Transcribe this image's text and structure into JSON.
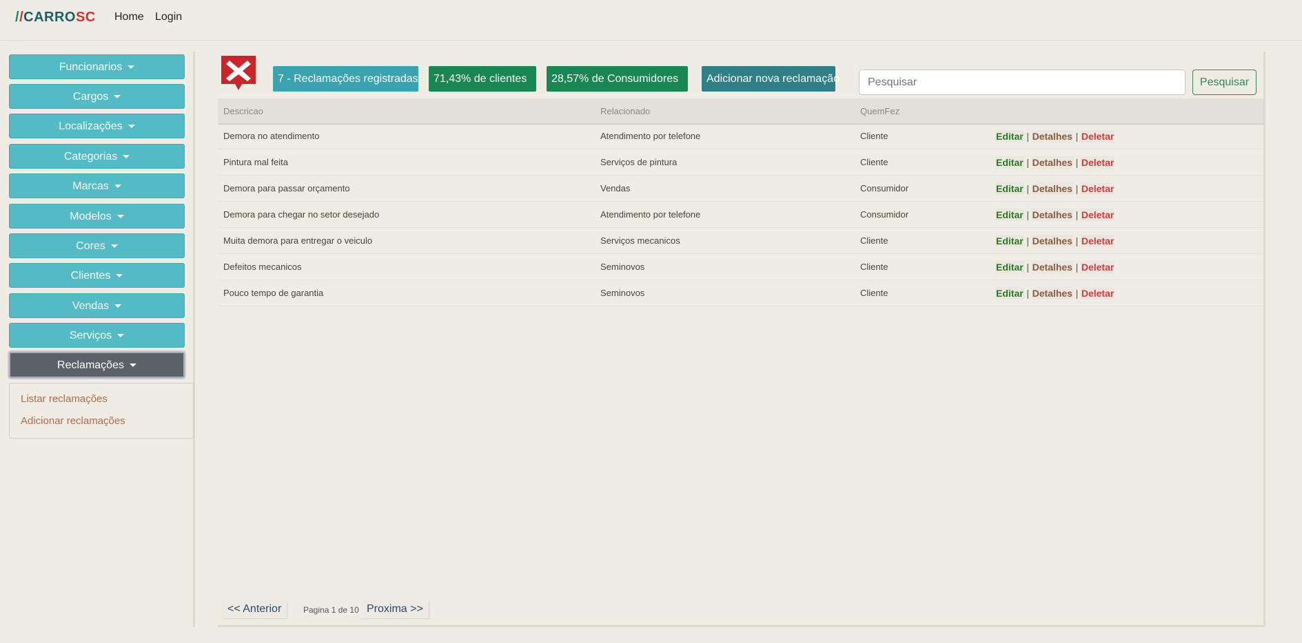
{
  "brand": {
    "mark": "/",
    "name_a": "CARRO",
    "name_b": "SC"
  },
  "nav": {
    "home": "Home",
    "login": "Login"
  },
  "sidebar": {
    "items": [
      {
        "label": "Funcionarios"
      },
      {
        "label": "Cargos"
      },
      {
        "label": "Localizações"
      },
      {
        "label": "Categorias"
      },
      {
        "label": "Marcas"
      },
      {
        "label": "Modelos"
      },
      {
        "label": "Cores"
      },
      {
        "label": "Clientes"
      },
      {
        "label": "Vendas"
      },
      {
        "label": "Serviços"
      },
      {
        "label": "Reclamações",
        "active": true
      }
    ],
    "dropdown": {
      "list": "Listar reclamações",
      "add": "Adicionar reclamações"
    }
  },
  "stats": {
    "total": "7 - Reclamações registradas",
    "clientes": "71,43% de clientes",
    "consumidores": "28,57% de Consumidores",
    "add_button": "Adicionar nova reclamação"
  },
  "search": {
    "placeholder": "Pesquisar",
    "button": "Pesquisar"
  },
  "table": {
    "headers": [
      "Descricao",
      "Relacionado",
      "QuemFez",
      ""
    ],
    "actions": {
      "edit": "Editar",
      "details": "Detalhes",
      "delete": "Deletar",
      "sep": "|"
    },
    "rows": [
      {
        "descricao": "Demora no atendimento",
        "relacionado": "Atendimento por telefone",
        "quemfez": "Cliente"
      },
      {
        "descricao": "Pintura mal feita",
        "relacionado": "Serviços de pintura",
        "quemfez": "Cliente"
      },
      {
        "descricao": "Demora para passar orçamento",
        "relacionado": "Vendas",
        "quemfez": "Consumidor"
      },
      {
        "descricao": "Demora para chegar no setor desejado",
        "relacionado": "Atendimento por telefone",
        "quemfez": "Consumidor"
      },
      {
        "descricao": "Muita demora para entregar o veiculo",
        "relacionado": "Serviços mecanicos",
        "quemfez": "Cliente"
      },
      {
        "descricao": "Defeitos mecanicos",
        "relacionado": "Seminovos",
        "quemfez": "Cliente"
      },
      {
        "descricao": "Pouco tempo de garantia",
        "relacionado": "Seminovos",
        "quemfez": "Cliente"
      }
    ]
  },
  "pagination": {
    "prev": "<< Anterior",
    "info_a": "Pagina ",
    "current": "1",
    "info_b": " de ",
    "total": "10",
    "next": "Proxima >>"
  },
  "colors": {
    "sidebar_button": "#52bbc5",
    "active_button": "#5a6169",
    "badge_teal": "#3aa3b0",
    "badge_green": "#198754",
    "badge_dark_teal": "#2e7f86",
    "edit": "#2a7a22",
    "details": "#8a5a3a",
    "delete": "#d43a3a"
  },
  "icons": {
    "logo": "x-marker-icon"
  }
}
